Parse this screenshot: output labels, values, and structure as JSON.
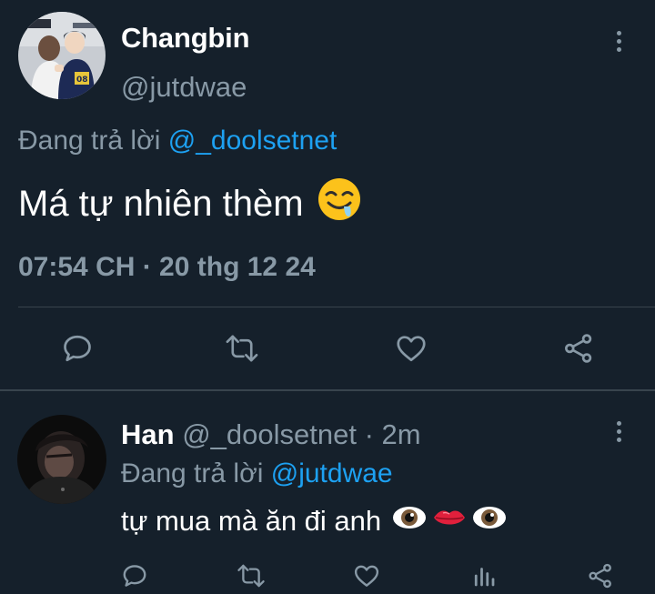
{
  "main_tweet": {
    "display_name": "Changbin",
    "handle": "@jutdwae",
    "replying_prefix": "Đang trả lời",
    "replying_mention": "@_doolsetnet",
    "text": "Má tự nhiên thèm",
    "emoji": "drooling-face-emoji",
    "timestamp": "07:54 CH · 20 thg 12 24",
    "actions": [
      "reply-icon",
      "retweet-icon",
      "like-icon",
      "share-icon"
    ]
  },
  "reply_tweet": {
    "display_name": "Han",
    "handle": "@_doolsetnet",
    "time_ago": "· 2m",
    "replying_prefix": "Đang trả lời",
    "replying_mention": "@jutdwae",
    "text": "tự mua mà ăn đi anh",
    "emojis": [
      "eye-emoji",
      "lips-emoji",
      "eye-emoji"
    ],
    "actions": [
      "reply-icon",
      "retweet-icon",
      "like-icon",
      "analytics-icon",
      "share-icon"
    ]
  },
  "colors": {
    "background": "#15202b",
    "text": "#ffffff",
    "secondary": "#8899a6",
    "accent": "#1da1f2",
    "divider": "#38444d"
  }
}
